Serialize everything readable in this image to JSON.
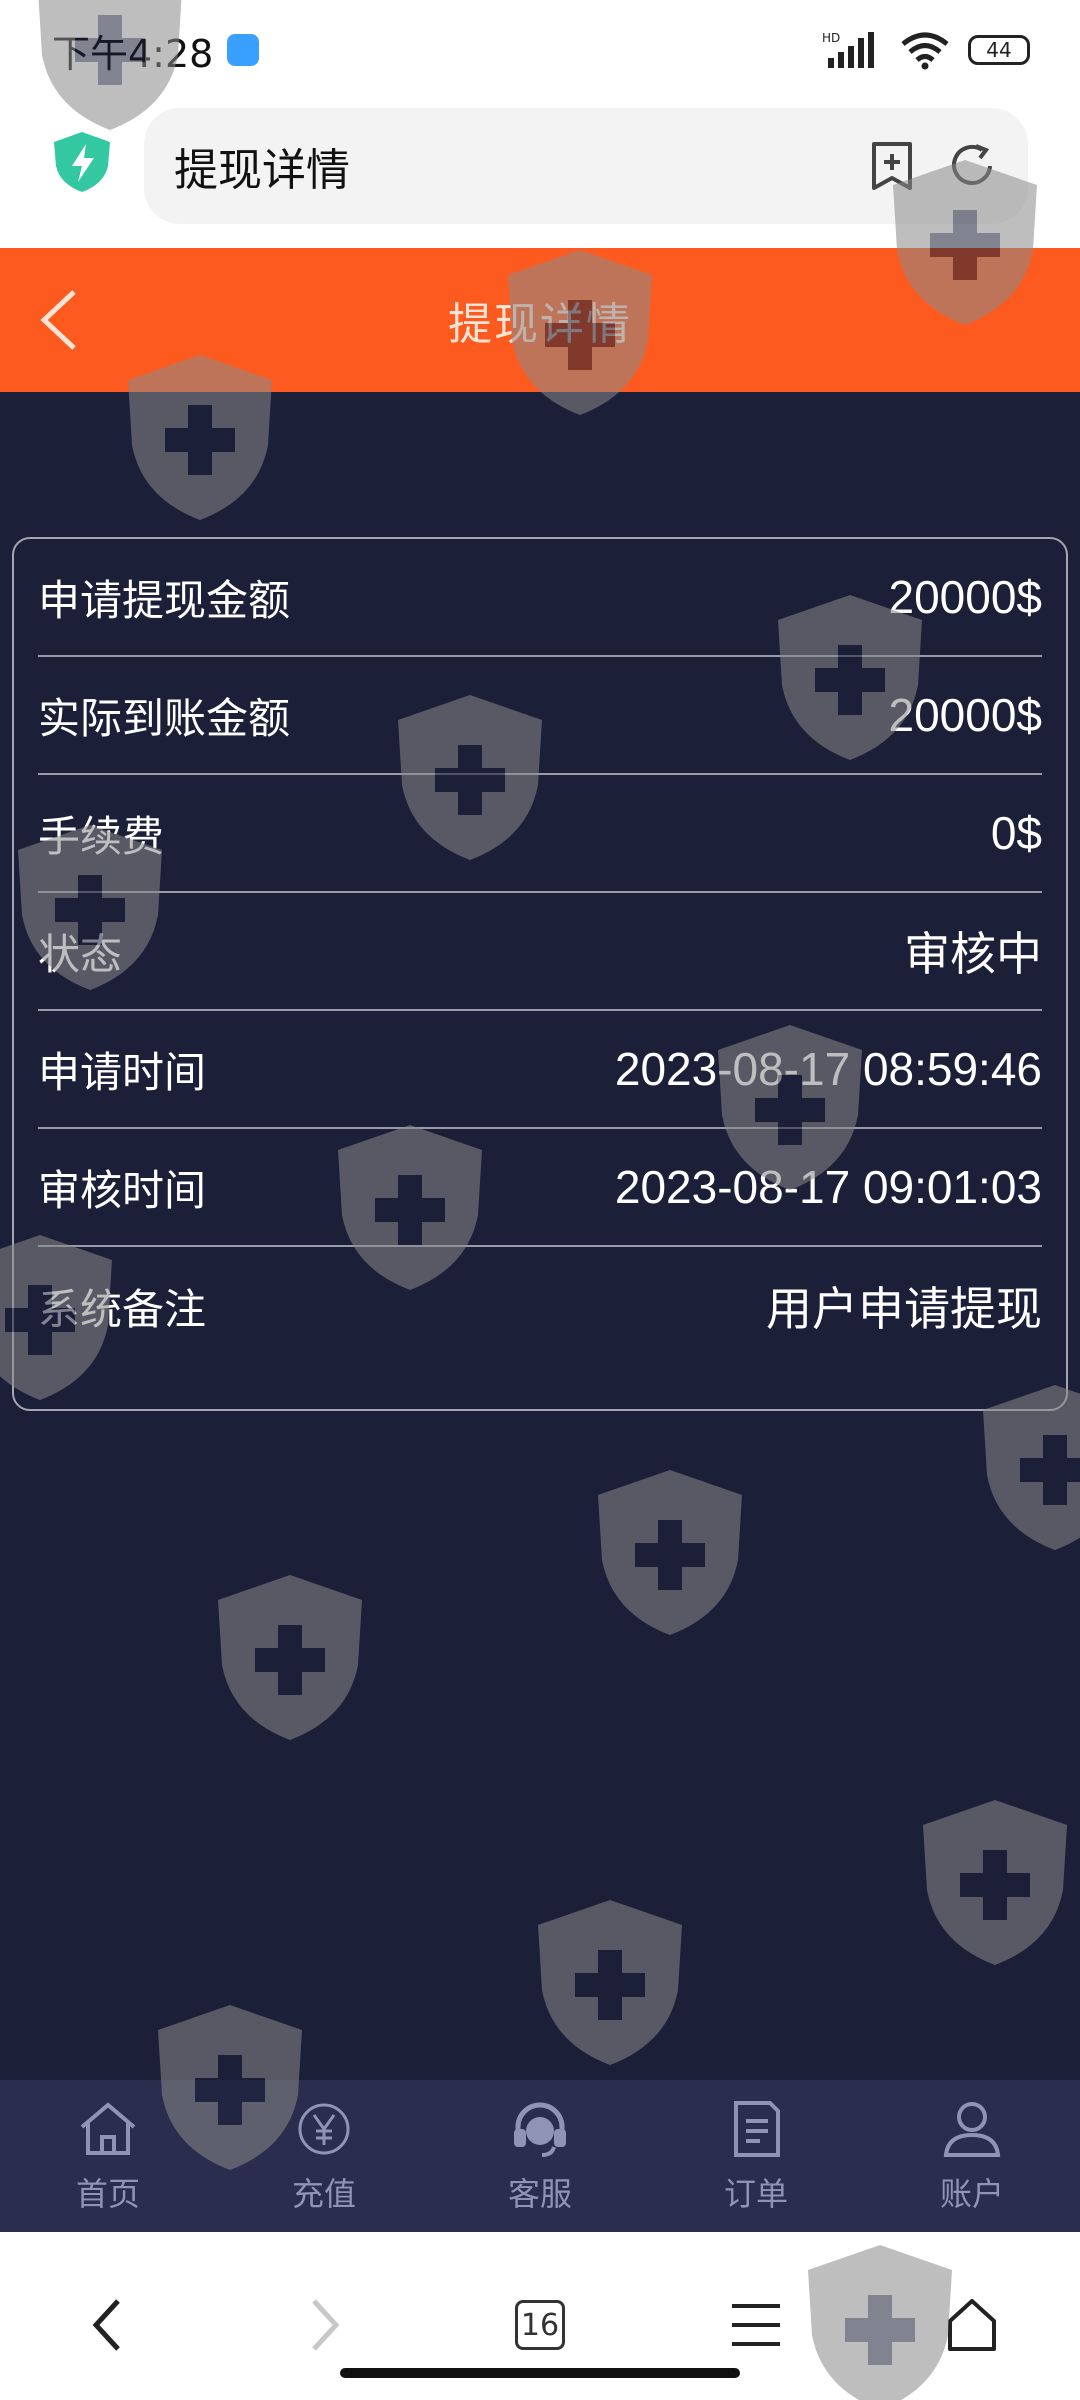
{
  "status_bar": {
    "time": "下午4:28",
    "network_label": "HD",
    "battery": "44"
  },
  "browser": {
    "address_text": "提现详情",
    "tabs_count": "16"
  },
  "header": {
    "title": "提现详情"
  },
  "details": [
    {
      "label": "申请提现金额",
      "value": "20000$"
    },
    {
      "label": "实际到账金额",
      "value": "20000$"
    },
    {
      "label": "手续费",
      "value": "0$"
    },
    {
      "label": "状态",
      "value": "审核中"
    },
    {
      "label": "申请时间",
      "value": "2023-08-17 08:59:46"
    },
    {
      "label": "审核时间",
      "value": "2023-08-17 09:01:03"
    },
    {
      "label": "系统备注",
      "value": "用户申请提现"
    }
  ],
  "app_nav": [
    {
      "label": "首页",
      "icon": "home-icon"
    },
    {
      "label": "充值",
      "icon": "yen-coin-icon"
    },
    {
      "label": "客服",
      "icon": "headset-icon"
    },
    {
      "label": "订单",
      "icon": "document-icon"
    },
    {
      "label": "账户",
      "icon": "user-icon"
    }
  ],
  "colors": {
    "header_orange": "#fd5a1f",
    "page_background": "#1c1f38",
    "nav_background": "#2a2d4d"
  }
}
